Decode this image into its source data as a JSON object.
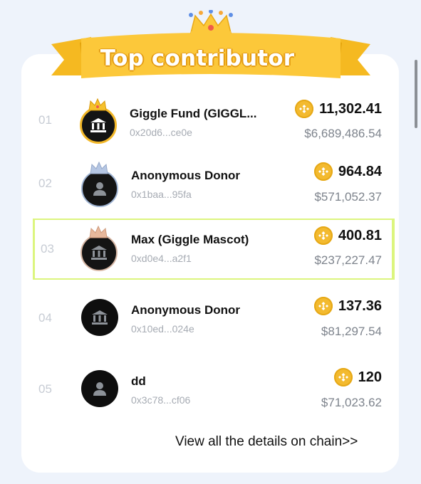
{
  "title": "Top contributor",
  "contributors": [
    {
      "rank": "01",
      "name": "Giggle Fund (GIGGL...",
      "address": "0x20d6...ce0e",
      "amount": "11,302.41",
      "usd": "$6,689,486.54",
      "icon": "bank-icon",
      "crown": "gold-crown-icon"
    },
    {
      "rank": "02",
      "name": "Anonymous Donor",
      "address": "0x1baa...95fa",
      "amount": "964.84",
      "usd": "$571,052.37",
      "icon": "person-icon",
      "crown": "silver-crown-icon"
    },
    {
      "rank": "03",
      "name": "Max (Giggle Mascot)",
      "address": "0xd0e4...a2f1",
      "amount": "400.81",
      "usd": "$237,227.47",
      "icon": "bank-icon",
      "crown": "bronze-crown-icon"
    },
    {
      "rank": "04",
      "name": "Anonymous Donor",
      "address": "0x10ed...024e",
      "amount": "137.36",
      "usd": "$81,297.54",
      "icon": "bank-icon",
      "crown": ""
    },
    {
      "rank": "05",
      "name": "dd",
      "address": "0x3c78...cf06",
      "amount": "120",
      "usd": "$71,023.62",
      "icon": "person-icon",
      "crown": ""
    }
  ],
  "view_all_link": "View all the details on chain>>",
  "colors": {
    "accent": "#f7c22f",
    "highlight_border": "#dcf57e",
    "coin": "#f3ba2f"
  }
}
